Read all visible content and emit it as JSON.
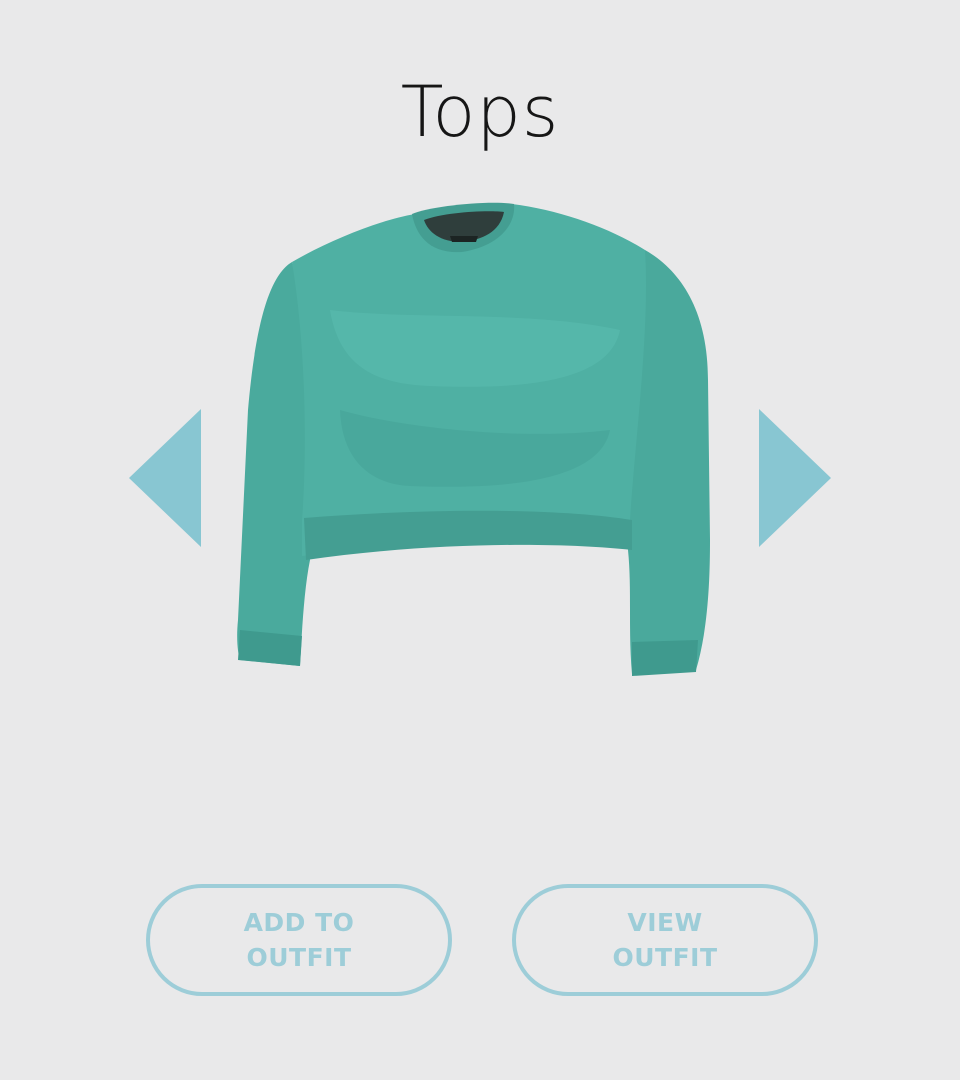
{
  "page": {
    "title": "Tops"
  },
  "carousel": {
    "prev_icon": "triangle-left-icon",
    "next_icon": "triangle-right-icon",
    "item": {
      "image_subject": "teal cropped crewneck sweatshirt",
      "color": "#4fada1"
    }
  },
  "actions": {
    "add_to_outfit_label": "ADD TO OUTFIT",
    "view_outfit_label": "VIEW OUTFIT"
  },
  "colors": {
    "background": "#e9e9ea",
    "accent": "#88c6d2",
    "button_outline": "#9dcdd8",
    "title_text": "#161616"
  }
}
